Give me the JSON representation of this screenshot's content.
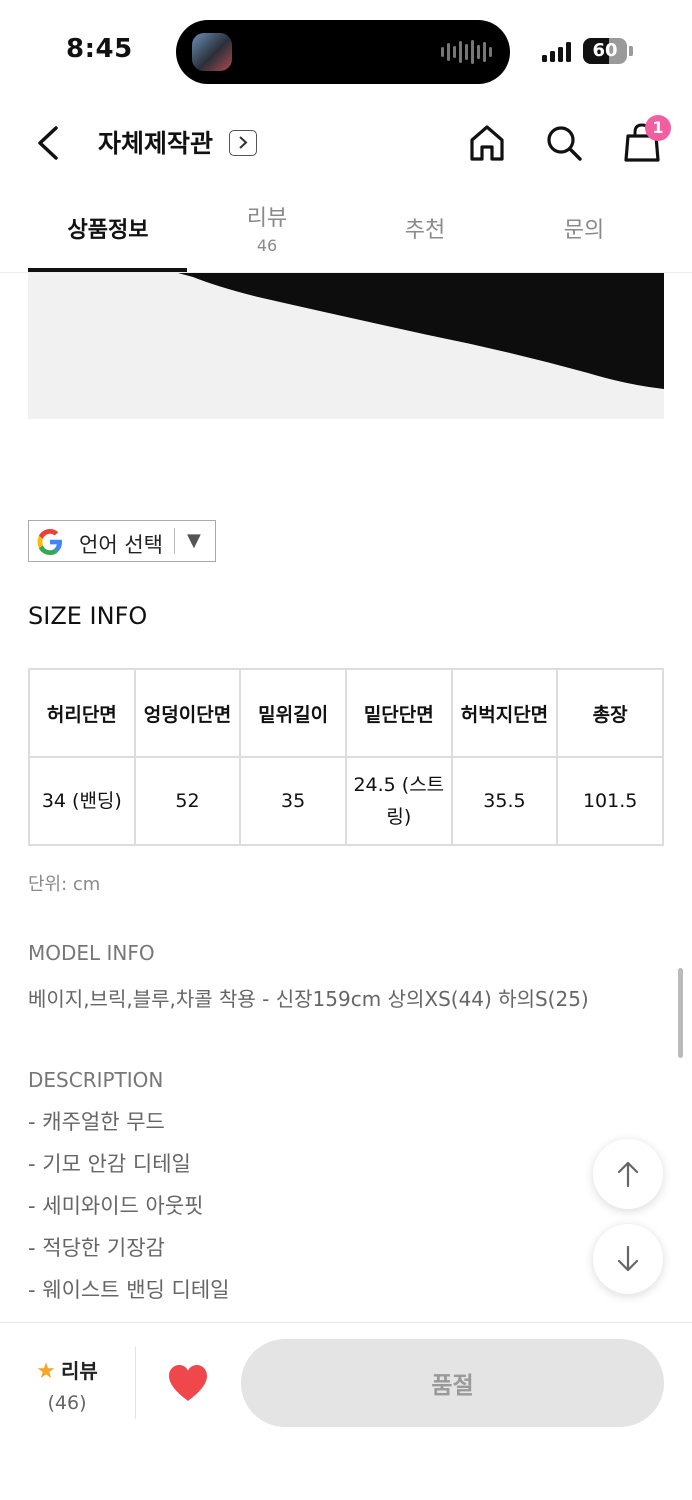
{
  "status_bar": {
    "time": "8:45",
    "battery": "60",
    "battery_level": 0.6
  },
  "header": {
    "store_title": "자체제작관",
    "cart_badge": "1"
  },
  "tabs": [
    {
      "label": "상품정보",
      "count": ""
    },
    {
      "label": "리뷰",
      "count": "46"
    },
    {
      "label": "추천",
      "count": ""
    },
    {
      "label": "문의",
      "count": ""
    }
  ],
  "translate": {
    "label": "언어 선택",
    "arrow": "▼"
  },
  "size_info": {
    "title": "SIZE INFO",
    "headers": [
      "허리단면",
      "엉덩이단면",
      "밑위길이",
      "밑단단면",
      "허벅지단면",
      "총장"
    ],
    "rows": [
      [
        "34 (밴딩)",
        "52",
        "35",
        "24.5 (스트링)",
        "35.5",
        "101.5"
      ]
    ],
    "unit": "단위: cm"
  },
  "model_info": {
    "title": "MODEL INFO",
    "text": "베이지,브릭,블루,차콜 착용 - 신장159cm 상의XS(44) 하의S(25)"
  },
  "description": {
    "title": "DESCRIPTION",
    "items": [
      "- 캐주얼한 무드",
      "- 기모 안감 디테일",
      "- 세미와이드 아웃핏",
      "- 적당한 기장감",
      "- 웨이스트 밴딩 디테일"
    ]
  },
  "bottom_bar": {
    "review_label": "리뷰",
    "review_count": "(46)",
    "buy_label": "품절"
  },
  "colors": {
    "accent_badge": "#f25fa0",
    "heart": "#f0474c",
    "star": "#f5a623",
    "soldout_bg": "#e4e4e4"
  }
}
